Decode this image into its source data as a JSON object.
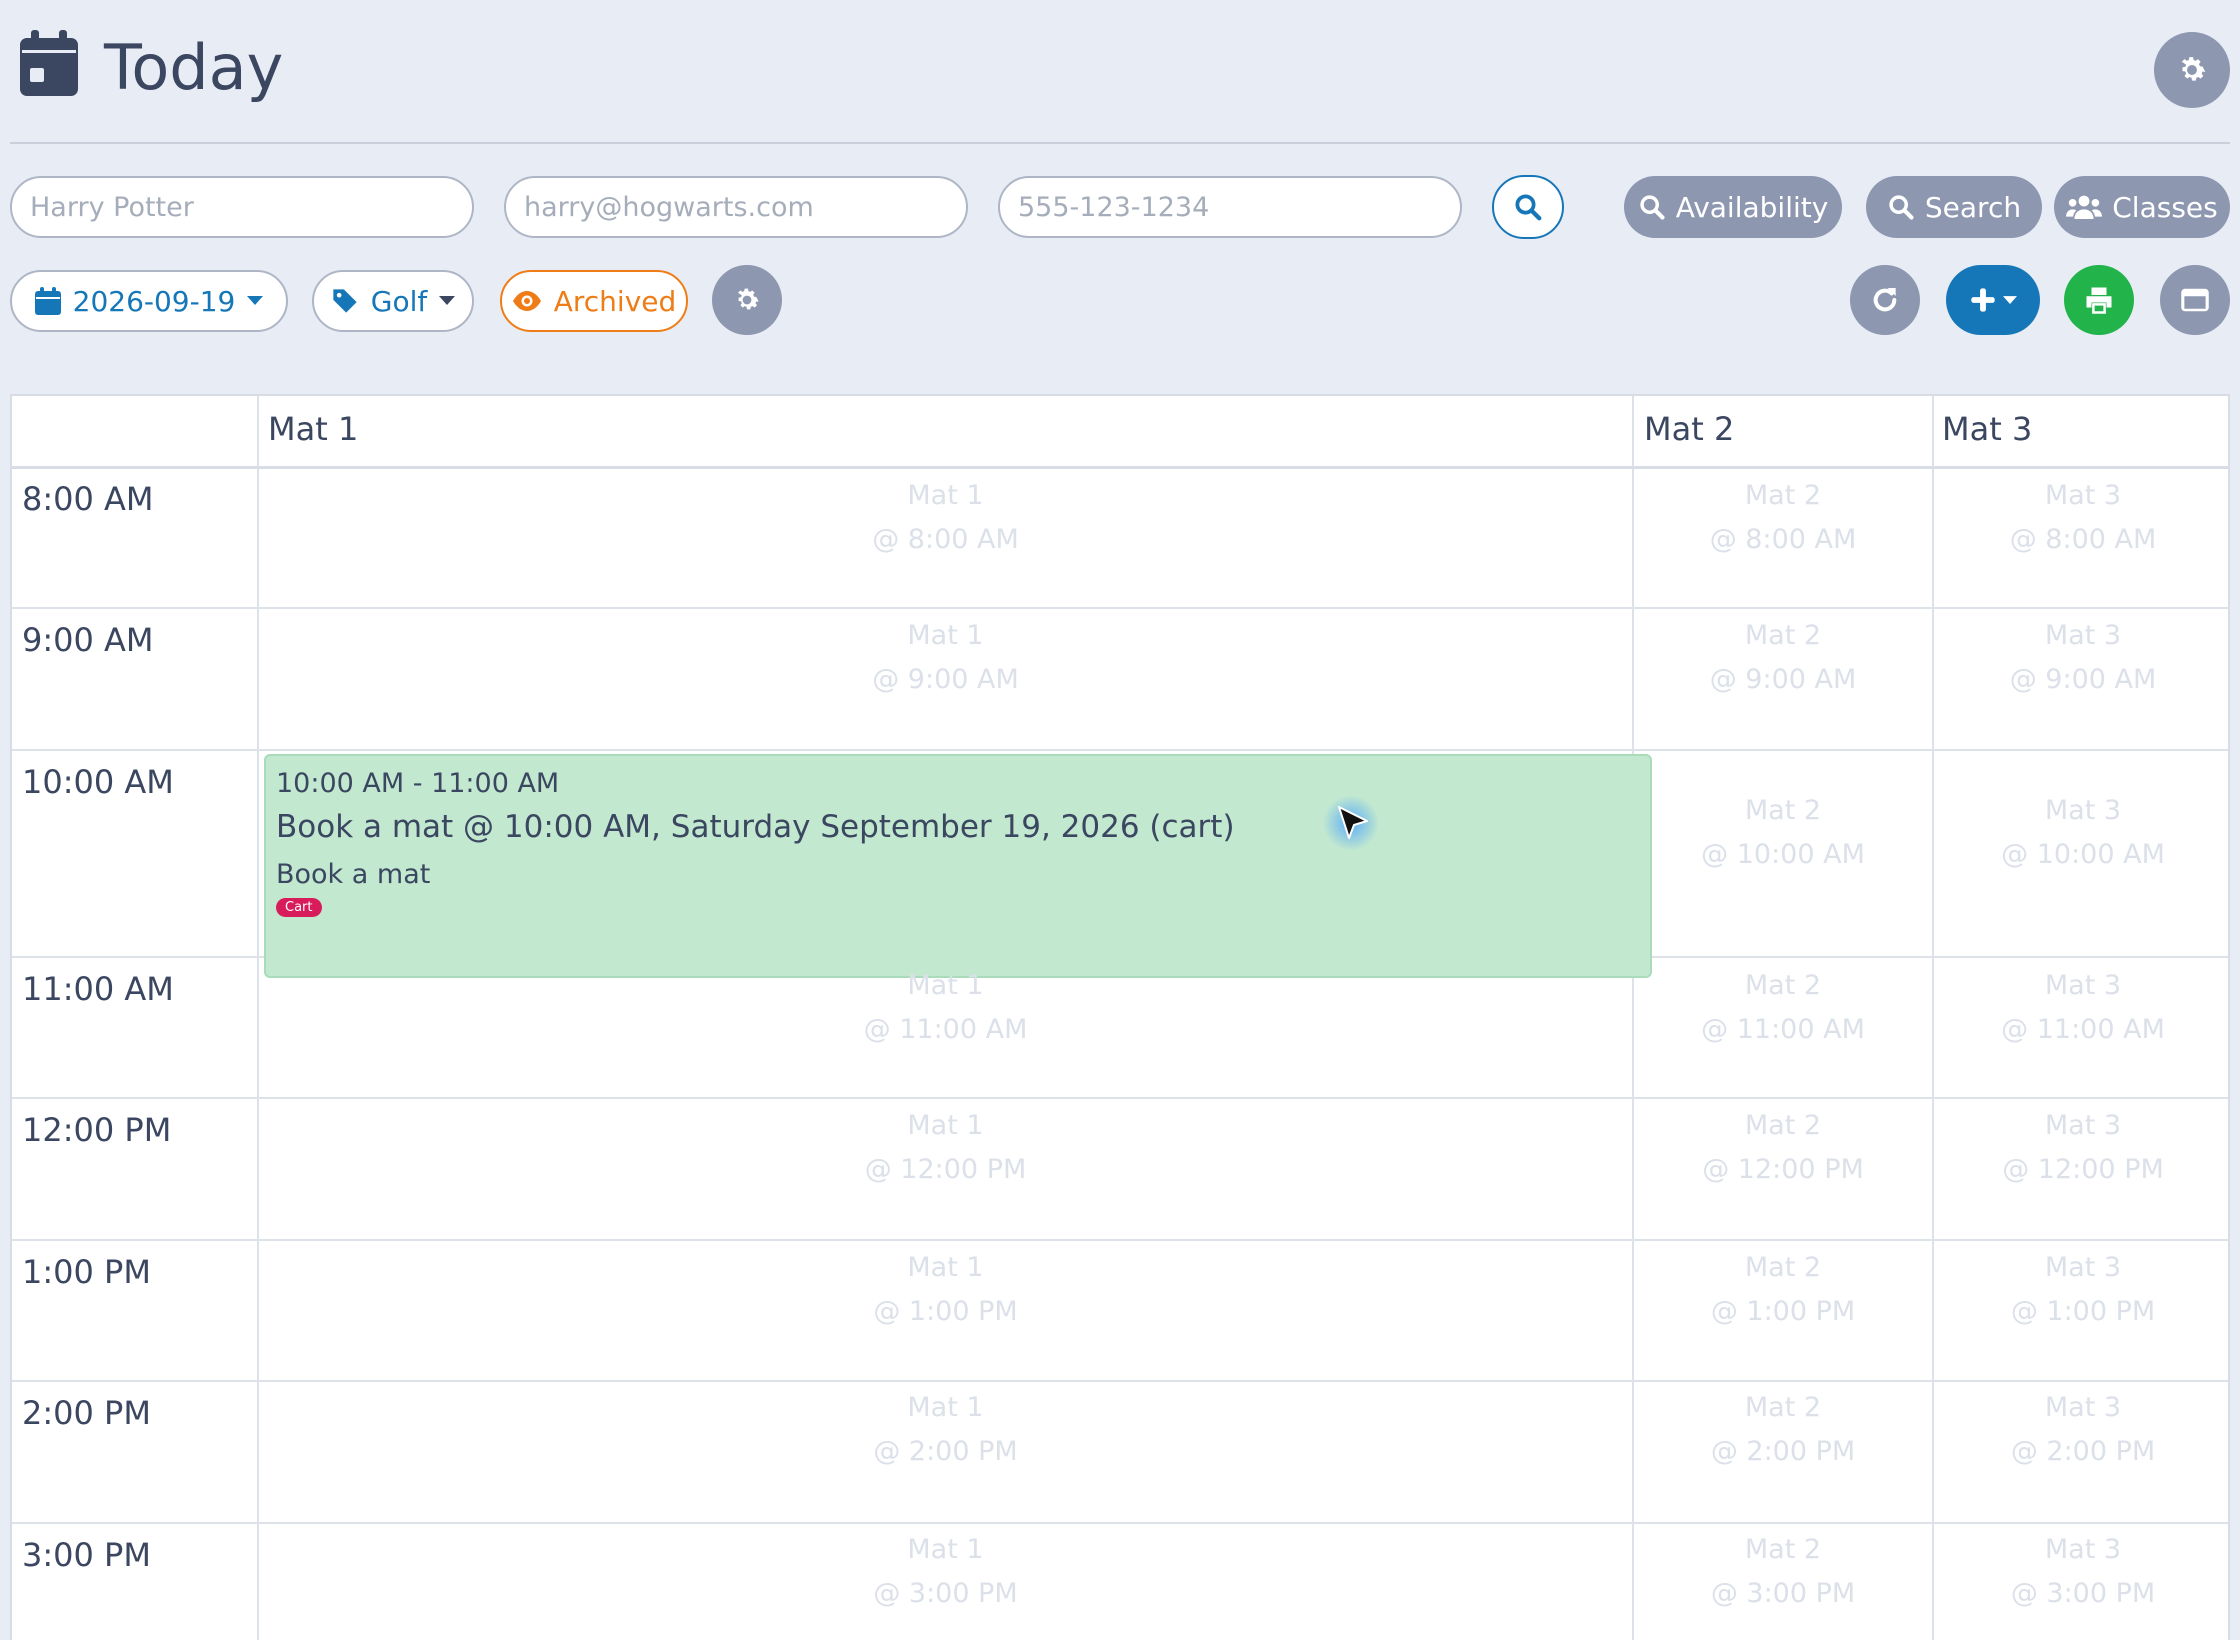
{
  "header": {
    "title": "Today",
    "icons": {
      "calendar": "calendar-icon",
      "settings": "gear-icon"
    }
  },
  "search_bar": {
    "name_placeholder": "Harry Potter",
    "email_placeholder": "harry@hogwarts.com",
    "phone_placeholder": "555-123-1234",
    "search_icon": "search-icon",
    "buttons": {
      "availability": "Availability",
      "search": "Search",
      "classes": "Classes"
    }
  },
  "toolbar": {
    "date": "2026-09-19",
    "tag": "Golf",
    "archived": "Archived",
    "icons": [
      "calendar-icon",
      "tag-icon",
      "eye-icon",
      "gear-icon",
      "refresh-icon",
      "plus-icon",
      "print-icon",
      "window-icon"
    ]
  },
  "calendar": {
    "columns": [
      "Mat 1",
      "Mat 2",
      "Mat 3"
    ],
    "rows": [
      {
        "time": "8:00 AM",
        "slots": [
          {
            "resource": "Mat 1",
            "at": "@ 8:00 AM"
          },
          {
            "resource": "Mat 2",
            "at": "@ 8:00 AM"
          },
          {
            "resource": "Mat 3",
            "at": "@ 8:00 AM"
          }
        ]
      },
      {
        "time": "9:00 AM",
        "slots": [
          {
            "resource": "Mat 1",
            "at": "@ 9:00 AM"
          },
          {
            "resource": "Mat 2",
            "at": "@ 9:00 AM"
          },
          {
            "resource": "Mat 3",
            "at": "@ 9:00 AM"
          }
        ]
      },
      {
        "time": "10:00 AM",
        "slots": [
          null,
          {
            "resource": "Mat 2",
            "at": "@ 10:00 AM"
          },
          {
            "resource": "Mat 3",
            "at": "@ 10:00 AM"
          }
        ]
      },
      {
        "time": "11:00 AM",
        "slots": [
          {
            "resource": "Mat 1",
            "at": "@ 11:00 AM"
          },
          {
            "resource": "Mat 2",
            "at": "@ 11:00 AM"
          },
          {
            "resource": "Mat 3",
            "at": "@ 11:00 AM"
          }
        ]
      },
      {
        "time": "12:00 PM",
        "slots": [
          {
            "resource": "Mat 1",
            "at": "@ 12:00 PM"
          },
          {
            "resource": "Mat 2",
            "at": "@ 12:00 PM"
          },
          {
            "resource": "Mat 3",
            "at": "@ 12:00 PM"
          }
        ]
      },
      {
        "time": "1:00 PM",
        "slots": [
          {
            "resource": "Mat 1",
            "at": "@ 1:00 PM"
          },
          {
            "resource": "Mat 2",
            "at": "@ 1:00 PM"
          },
          {
            "resource": "Mat 3",
            "at": "@ 1:00 PM"
          }
        ]
      },
      {
        "time": "2:00 PM",
        "slots": [
          {
            "resource": "Mat 1",
            "at": "@ 2:00 PM"
          },
          {
            "resource": "Mat 2",
            "at": "@ 2:00 PM"
          },
          {
            "resource": "Mat 3",
            "at": "@ 2:00 PM"
          }
        ]
      },
      {
        "time": "3:00 PM",
        "slots": [
          {
            "resource": "Mat 1",
            "at": "@ 3:00 PM"
          },
          {
            "resource": "Mat 2",
            "at": "@ 3:00 PM"
          },
          {
            "resource": "Mat 3",
            "at": "@ 3:00 PM"
          }
        ]
      }
    ],
    "event": {
      "time_range": "10:00 AM - 11:00 AM",
      "title": "Book a mat @ 10:00 AM, Saturday September 19, 2026 (cart)",
      "subtitle": "Book a mat",
      "badge": "Cart"
    }
  },
  "colors": {
    "background": "#e8ecf5",
    "accent": "#1677b8",
    "archived": "#ef7d17",
    "print": "#22b34a",
    "event": "#c2e8cf",
    "badge": "#d81b5b",
    "gray_button": "#8d97b0"
  }
}
